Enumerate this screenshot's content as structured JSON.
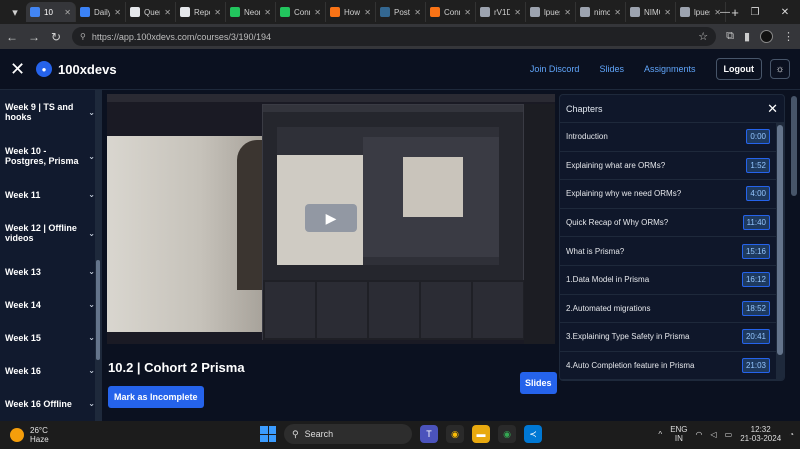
{
  "browser": {
    "tabs": [
      {
        "label": "10",
        "color": "#4285f4",
        "active": true
      },
      {
        "label": "Daily",
        "color": "#3b82f6"
      },
      {
        "label": "Quer",
        "color": "#e5e7eb"
      },
      {
        "label": "Repo",
        "color": "#e5e7eb"
      },
      {
        "label": "Neon",
        "color": "#22c55e"
      },
      {
        "label": "Conn",
        "color": "#22c55e"
      },
      {
        "label": "How d",
        "color": "#f97316"
      },
      {
        "label": "Postg",
        "color": "#336791"
      },
      {
        "label": "Conn",
        "color": "#f97316"
      },
      {
        "label": "rV1DE",
        "color": "#9ca3af"
      },
      {
        "label": "lpues",
        "color": "#9ca3af"
      },
      {
        "label": "nimc",
        "color": "#9ca3af"
      },
      {
        "label": "NIMC",
        "color": "#9ca3af"
      },
      {
        "label": "lpues",
        "color": "#9ca3af"
      }
    ],
    "new_tab": "+",
    "url": "https://app.100xdevs.com/courses/3/190/194"
  },
  "header": {
    "brand": "100xdevs",
    "links": [
      "Join Discord",
      "Slides",
      "Assignments"
    ],
    "logout": "Logout"
  },
  "sidebar": {
    "weeks": [
      {
        "label": "Week 9 | TS and hooks",
        "tall": true
      },
      {
        "label": "Week 10 - Postgres, Prisma",
        "tall": true
      },
      {
        "label": "Week 11",
        "tall": false
      },
      {
        "label": "Week 12 | Offline videos",
        "tall": true
      },
      {
        "label": "Week 13",
        "tall": false
      },
      {
        "label": "Week 14",
        "tall": false
      },
      {
        "label": "Week 15",
        "tall": false
      },
      {
        "label": "Week 16",
        "tall": false
      },
      {
        "label": "Week 16 Offline",
        "tall": false
      }
    ]
  },
  "lesson": {
    "title": "10.2 | Cohort 2 Prisma",
    "mark_button": "Mark as Incomplete",
    "slides_button": "Slides"
  },
  "chapters": {
    "heading": "Chapters",
    "items": [
      {
        "label": "Introduction",
        "time": "0:00"
      },
      {
        "label": "Explaining what are ORMs?",
        "time": "1:52"
      },
      {
        "label": "Explaining why we need ORMs?",
        "time": "4:00"
      },
      {
        "label": "Quick Recap of Why ORMs?",
        "time": "11:40"
      },
      {
        "label": "What is Prisma?",
        "time": "15:16"
      },
      {
        "label": "1.Data Model in Prisma",
        "time": "16:12"
      },
      {
        "label": "2.Automated migrations",
        "time": "18:52"
      },
      {
        "label": "3.Explaining Type Safety in Prisma",
        "time": "20:41"
      },
      {
        "label": "4.Auto Completion feature in Prisma",
        "time": "21:03"
      }
    ]
  },
  "taskbar": {
    "temp": "26°C",
    "weather": "Haze",
    "search": "Search",
    "lang1": "ENG",
    "lang2": "IN",
    "time": "12:32",
    "date": "21-03-2024"
  }
}
